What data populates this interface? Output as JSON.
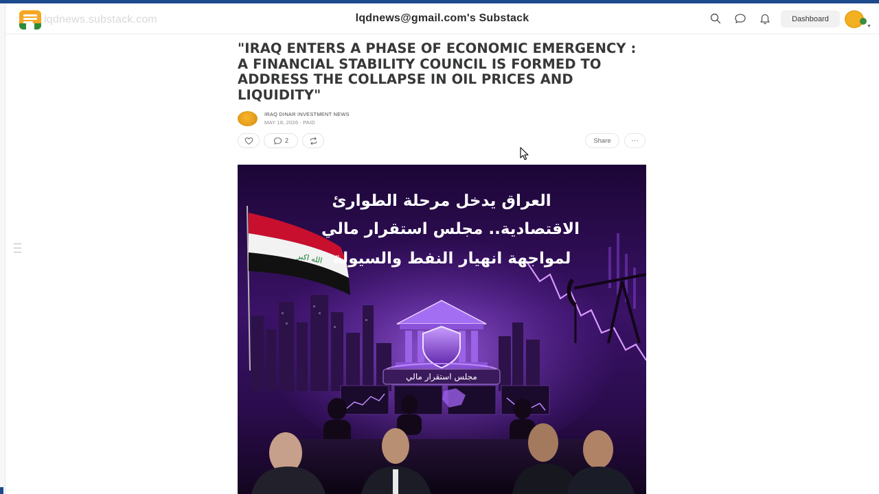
{
  "header": {
    "site_url": "lqdnews.substack.com",
    "publication_title": "lqdnews@gmail.com's Substack",
    "icons": [
      "search-icon",
      "chat-icon",
      "bell-icon"
    ],
    "dashboard_label": "Dashboard"
  },
  "article": {
    "title": "\"IRAQ ENTERS A PHASE OF ECONOMIC EMERGENCY : A FINANCIAL STABILITY COUNCIL IS FORMED TO ADDRESS THE COLLAPSE IN OIL PRICES AND LIQUIDITY\"",
    "author": "IRAQ DINAR INVESTMENT NEWS",
    "meta": "MAY 18, 2026 ∙ PAID",
    "actions": {
      "like_icon": "heart-icon",
      "comment_count": "2",
      "comment_icon": "comment-icon",
      "restack_icon": "restack-icon",
      "share_label": "Share",
      "more_label": "···"
    },
    "hero_image": {
      "headline_lines": [
        "العراق يدخل مرحلة الطوارئ",
        "الاقتصادية.. مجلس استقرار مالي",
        "لمواجهة انهيار النفط والسيولة"
      ],
      "badge": "مجلس استقرار مالي",
      "flag_text": "الله اكبر"
    }
  },
  "colors": {
    "accent": "#1d4a8c",
    "brand_orange": "#f5a623",
    "hero_purple": "#2a0d4a"
  }
}
